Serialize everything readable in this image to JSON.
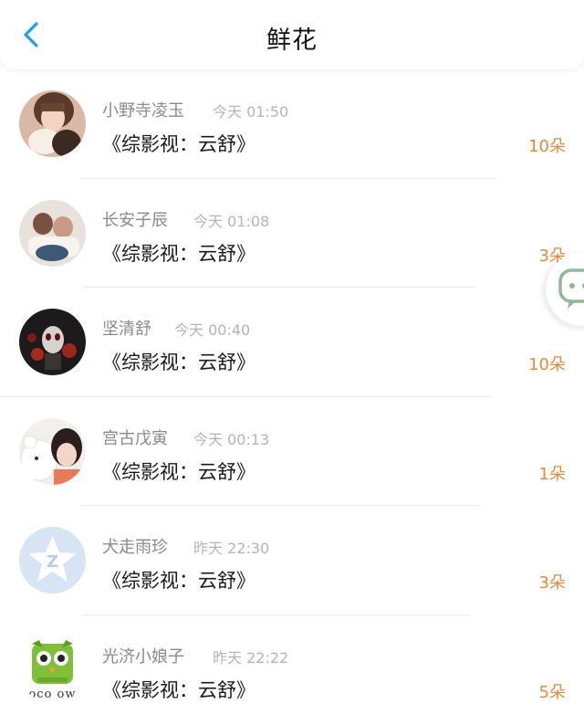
{
  "header": {
    "title": "鲜花"
  },
  "icons": {
    "back": "chevron-left-icon",
    "float": "chat-bubble-icon"
  },
  "colors": {
    "back": "#1aa1f0",
    "count": "#e58a3c"
  },
  "items": [
    {
      "name": "小野寺凌玉",
      "time": "今天 01:50",
      "book": "《综影视：云舒》",
      "count": "10朵"
    },
    {
      "name": "长安子辰",
      "time": "今天 01:08",
      "book": "《综影视：云舒》",
      "count": "3朵"
    },
    {
      "name": "坚清舒",
      "time": "今天 00:40",
      "book": "《综影视：云舒》",
      "count": "10朵"
    },
    {
      "name": "宫古戊寅",
      "time": "今天 00:13",
      "book": "《综影视：云舒》",
      "count": "1朵"
    },
    {
      "name": "犬走雨珍",
      "time": "昨天 22:30",
      "book": "《综影视：云舒》",
      "count": "3朵"
    },
    {
      "name": "光济小娘子",
      "time": "昨天 22:22",
      "book": "《综影视：云舒》",
      "count": "5朵",
      "avatar_text": "oco ow"
    }
  ]
}
